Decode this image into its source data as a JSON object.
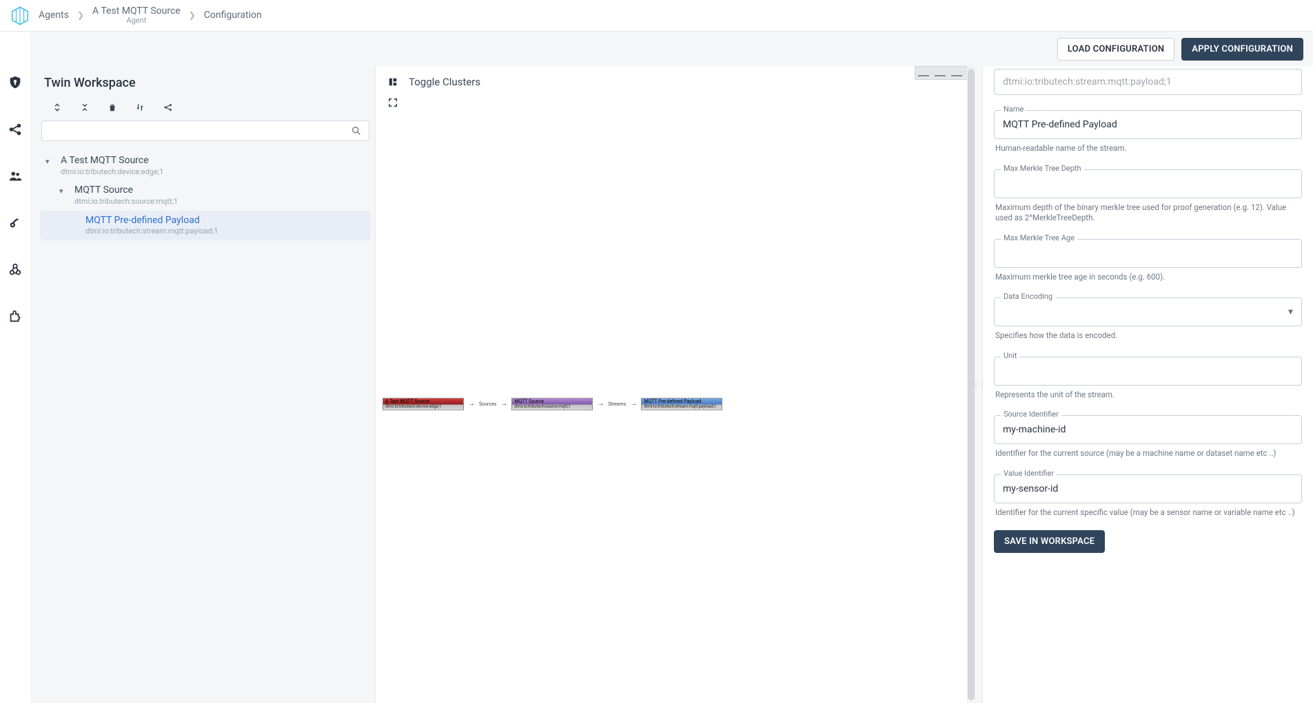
{
  "breadcrumb": {
    "agents": "Agents",
    "source_name": "A Test MQTT Source",
    "source_type": "Agent",
    "configuration": "Configuration"
  },
  "toolbar": {
    "load": "LOAD CONFIGURATION",
    "apply": "APPLY CONFIGURATION"
  },
  "workspace": {
    "title": "Twin Workspace",
    "search_placeholder": "",
    "tree": {
      "root": {
        "title": "A Test MQTT Source",
        "sub": "dtmi:io:tributech:device:edge;1"
      },
      "source": {
        "title": "MQTT Source",
        "sub": "dtmi:io:tributech:source:mqtt;1"
      },
      "stream": {
        "title": "MQTT Pre-defined Payload",
        "sub": "dtmi:io:tributech:stream:mqtt:payload;1"
      }
    }
  },
  "canvas": {
    "toggle_label": "Toggle Clusters",
    "graph": {
      "n1_title": "A Test MQTT Source",
      "n1_sub": "dtmi:io:tributech:device:edge;1",
      "e1": "Sources",
      "n2_title": "MQTT Source",
      "n2_sub": "dtmi:io:tributech:source:mqtt;1",
      "e2": "Streams",
      "n3_title": "MQTT Pre-defined Payload",
      "n3_sub": "dtmi:io:tributech:stream:mqtt:payload;1"
    }
  },
  "form": {
    "top_cut": "dtmi:io:tributech:stream:mqtt:payload;1",
    "name": {
      "label": "Name",
      "value": "MQTT Pre-defined Payload",
      "help": "Human-readable name of the stream."
    },
    "depth": {
      "label": "Max Merkle Tree Depth",
      "value": "",
      "help": "Maximum depth of the binary merkle tree used for proof generation (e.g. 12). Value used as 2^MerkleTreeDepth."
    },
    "age": {
      "label": "Max Merkle Tree Age",
      "value": "",
      "help": "Maximum merkle tree age in seconds (e.g. 600)."
    },
    "encoding": {
      "label": "Data Encoding",
      "value": "",
      "help": "Specifies how the data is encoded."
    },
    "unit": {
      "label": "Unit",
      "value": "",
      "help": "Represents the unit of the stream."
    },
    "sourceid": {
      "label": "Source Identifier",
      "value": "my-machine-id",
      "help": "Identifier for the current source (may be a machine name or dataset name etc ..)"
    },
    "valueid": {
      "label": "Value Identifier",
      "value": "my-sensor-id",
      "help": "Identifier for the current specific value (may be a sensor name or variable name etc ..)"
    },
    "save": "SAVE IN WORKSPACE"
  }
}
